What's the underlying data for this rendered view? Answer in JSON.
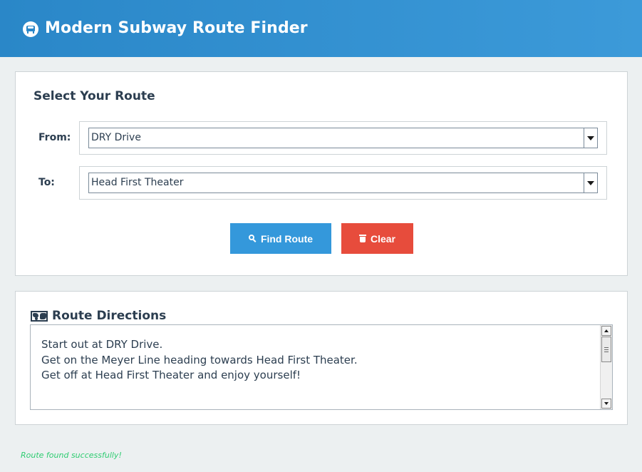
{
  "header": {
    "title": "Modern Subway Route Finder",
    "icon": "subway-icon",
    "background": "#2e8dd0"
  },
  "route_panel": {
    "title": "Select Your Route",
    "from": {
      "label": "From:",
      "selected": "DRY Drive"
    },
    "to": {
      "label": "To:",
      "selected": "Head First Theater"
    },
    "find_button": {
      "label": "Find Route",
      "icon": "search-icon",
      "color": "#3498db"
    },
    "clear_button": {
      "label": "Clear",
      "icon": "trash-icon",
      "color": "#e74c3c"
    }
  },
  "directions_panel": {
    "title": "Route Directions",
    "icon": "map-icon",
    "lines": [
      "Start out at DRY Drive.",
      "Get on the Meyer Line heading towards Head First Theater.",
      "Get off at Head First Theater and enjoy yourself!"
    ]
  },
  "status": {
    "text": "Route found successfully!",
    "color": "#2ecc71"
  }
}
